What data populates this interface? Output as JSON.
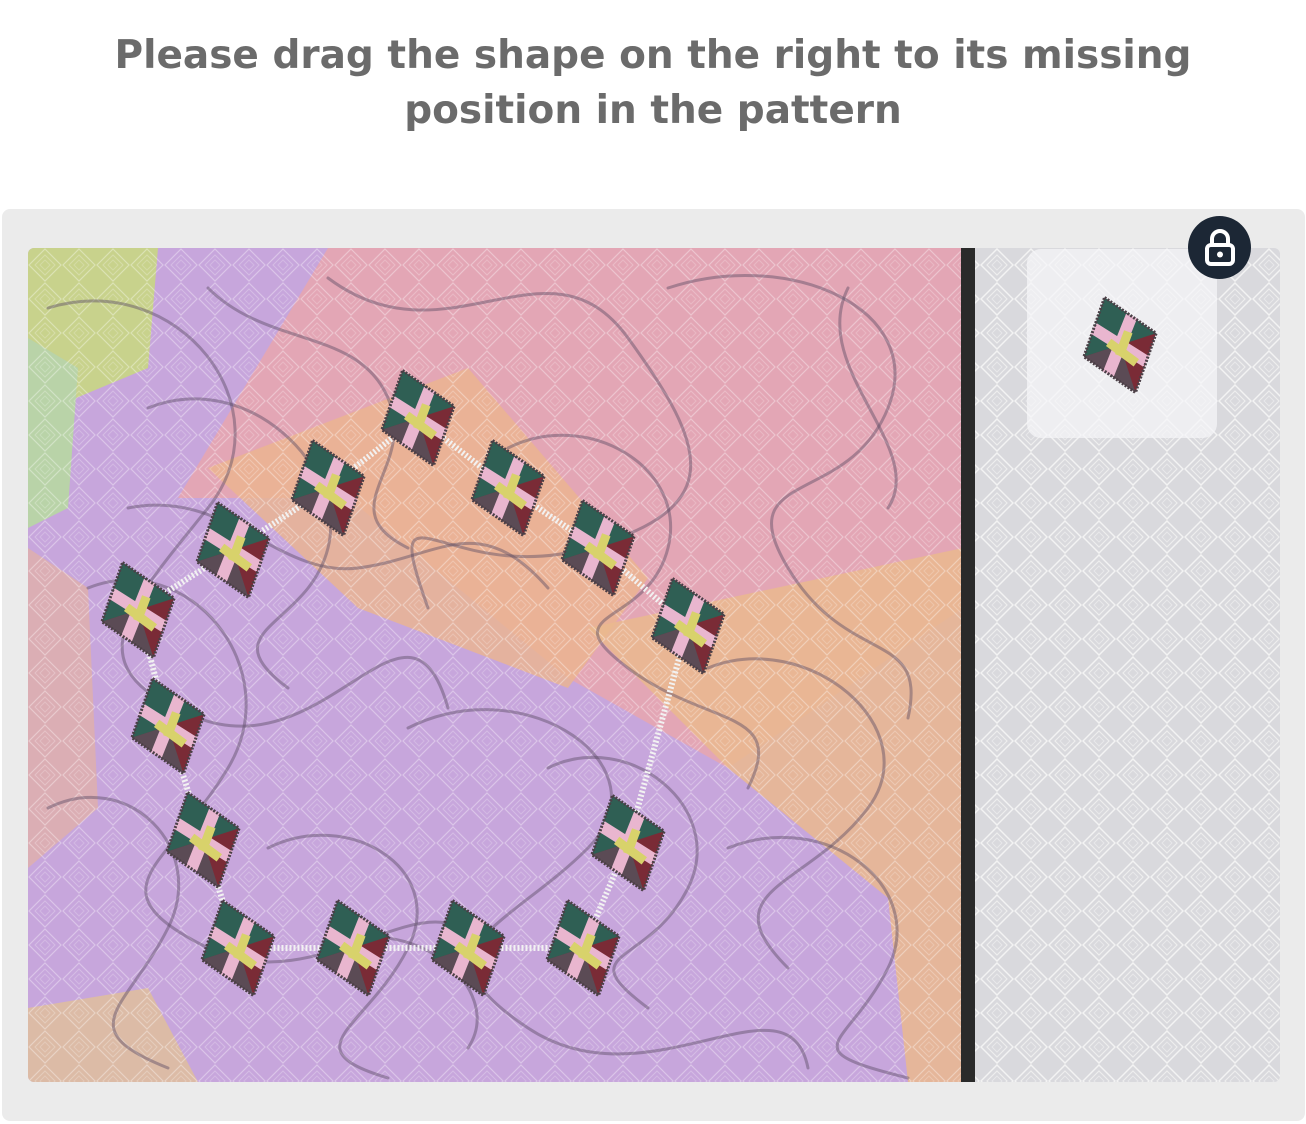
{
  "prompt": {
    "text": "Please drag the shape on the right to its missing position in the pattern"
  },
  "puzzle": {
    "pattern_piece_count": 14,
    "missing_piece_count": 1,
    "colors": {
      "frame_background": "#ebebeb",
      "divider": "#222222",
      "piece_dark_green": "#2f5f54",
      "piece_maroon": "#7a2b36",
      "piece_pink": "#e9b6cf",
      "piece_yellow": "#d8d26b",
      "lock_button": "#1c2735"
    }
  },
  "icons": {
    "lock": "padlock-icon"
  }
}
